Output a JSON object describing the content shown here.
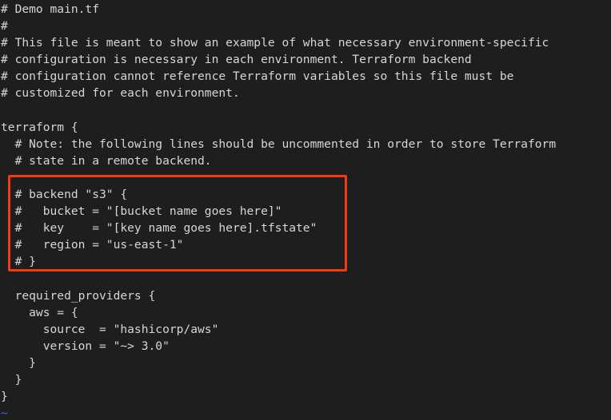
{
  "editor": {
    "background_color": "#1e1e1e",
    "text_color": "#d6d6d6",
    "tilde_color": "#3b6fd4",
    "highlight_color": "#ef3c10",
    "filename": "main.tf",
    "lines": [
      "# Demo main.tf",
      "#",
      "# This file is meant to show an example of what necessary environment-specific",
      "# configuration is necessary in each environment. Terraform backend",
      "# configuration cannot reference Terraform variables so this file must be",
      "# customized for each environment.",
      "",
      "terraform {",
      "  # Note: the following lines should be uncommented in order to store Terraform",
      "  # state in a remote backend.",
      "",
      "  # backend \"s3\" {",
      "  #   bucket = \"[bucket name goes here]\"",
      "  #   key    = \"[key name goes here].tfstate\"",
      "  #   region = \"us-east-1\"",
      "  # }",
      "",
      "  required_providers {",
      "    aws = {",
      "      source  = \"hashicorp/aws\"",
      "      version = \"~> 3.0\"",
      "    }",
      "  }",
      "}",
      "~"
    ]
  },
  "annotation": {
    "label": "backend-block-highlight",
    "color": "#ef3c10"
  }
}
